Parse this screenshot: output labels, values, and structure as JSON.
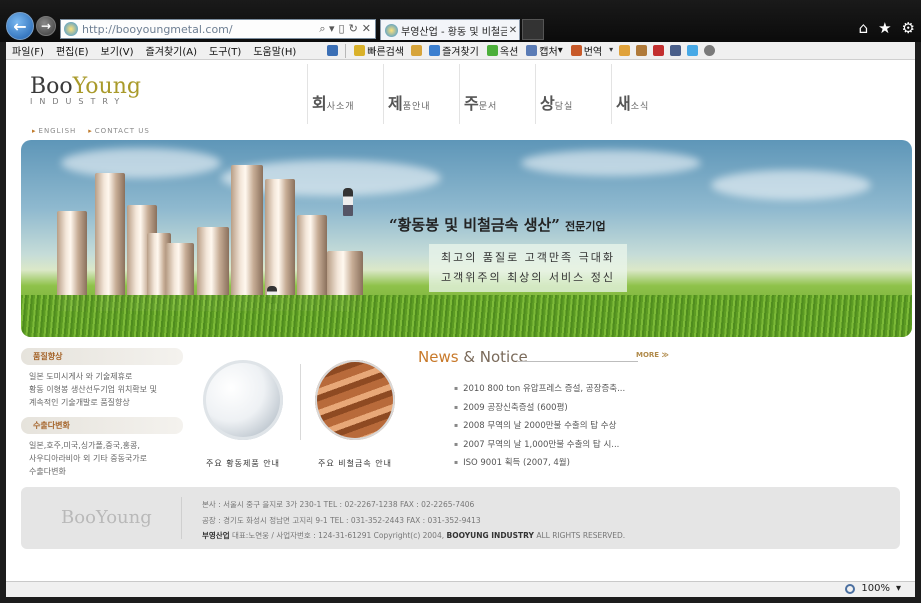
{
  "browser": {
    "url": "http://booyoungmetal.com/",
    "tab_title": "부영산업 - 황동 및 비철금...",
    "tab_close": "✕",
    "address_tools": [
      "⌕ ▾",
      "▯",
      "↻",
      "✕"
    ],
    "menus": [
      "파일(F)",
      "편집(E)",
      "보기(V)",
      "즐겨찾기(A)",
      "도구(T)",
      "도움말(H)"
    ],
    "toolbar": {
      "quick_search": "빠른검색",
      "favorites": "즐겨찾기",
      "leaf": "옥션",
      "capture": "캡처",
      "translate": "번역"
    },
    "zoom": "100%"
  },
  "site": {
    "logo_main_1": "Boo",
    "logo_main_2": "Young",
    "logo_sub": "INDUSTRY",
    "nav": [
      {
        "big": "회",
        "small": "사소개"
      },
      {
        "big": "제",
        "small": "품안내"
      },
      {
        "big": "주",
        "small": "문서"
      },
      {
        "big": "상",
        "small": "담실"
      },
      {
        "big": "새",
        "small": "소식"
      }
    ],
    "lang_links": [
      "ENGLISH",
      "CONTACT US"
    ],
    "hero": {
      "headline": "“황동봉 및 비철금속 생산”",
      "headline_suffix": "전문기업",
      "tagline_1": "최고의 품질로 고객만족 극대화",
      "tagline_2": "고객위주의 최상의 서비스 정신"
    },
    "sidebar": [
      {
        "title": "품질향상",
        "lines": [
          "일본 도미시게사 와 기술제휴로",
          "황동 이형봉 생산선두기업 위치확보 및",
          "계속적인 기술개발로 품질향상"
        ]
      },
      {
        "title": "수출다변화",
        "lines": [
          "일본,호주,미국,싱가폴,중국,홍콩,",
          "사우디아라비아 외 기타 중동국가로",
          "수출다변화"
        ]
      }
    ],
    "products": [
      {
        "caption": "주요 황동제품 안내"
      },
      {
        "caption": "주요 비철금속 안내"
      }
    ],
    "news": {
      "title_1": "News",
      "title_2": " & Notice",
      "more": "MORE ≫",
      "items": [
        "2010 800 ton 유압프레스 증설, 공장증축...",
        "2009 공장신축증설 (600평)",
        "2008 무역의 날 2000만불 수출의 탑 수상",
        "2007 무역의 날 1,000만불 수출의 탑 시...",
        "ISO 9001 획득 (2007, 4월)"
      ]
    },
    "footer": {
      "logo": "BooYoung",
      "line1": "본사 : 서울시 중구 을지로 3가 230-1      TEL : 02-2267-1238   FAX : 02-2265-7406",
      "line2": "공장 : 경기도 화성시 정남면 고지리 9-1   TEL : 031-352-2443   FAX : 031-352-9413",
      "company": "부영산업",
      "line3": " 대표:노연웅 / 사업자번호 : 124-31-61291 Copyright(c) 2004, ",
      "company_en": "BOOYUNG INDUSTRY",
      "line3_end": " ALL RIGHTS RESERVED."
    }
  }
}
